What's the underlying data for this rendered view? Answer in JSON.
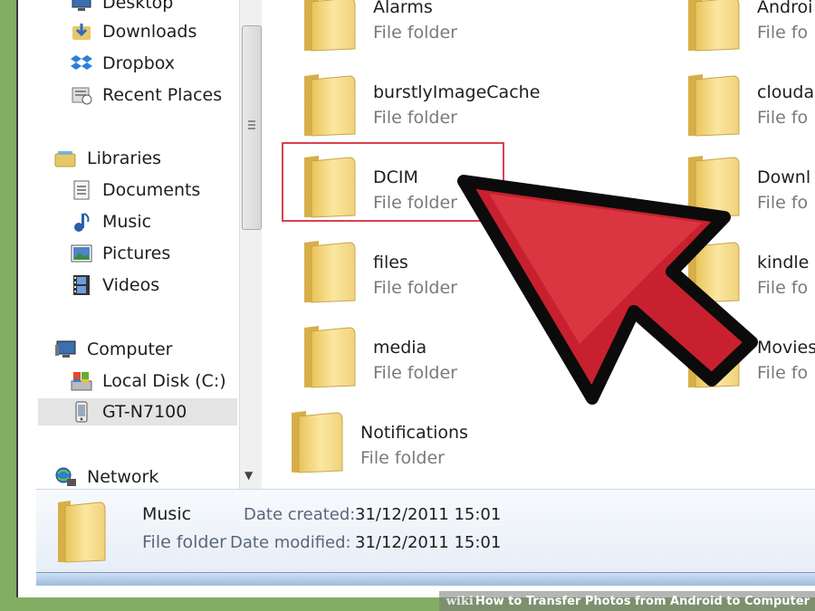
{
  "navigation": {
    "favorites": [
      {
        "label": "Desktop",
        "icon": "desktop-icon"
      },
      {
        "label": "Downloads",
        "icon": "downloads-icon"
      },
      {
        "label": "Dropbox",
        "icon": "dropbox-icon"
      },
      {
        "label": "Recent Places",
        "icon": "recent-places-icon"
      }
    ],
    "libraries": {
      "label": "Libraries",
      "icon": "libraries-icon",
      "items": [
        {
          "label": "Documents",
          "icon": "documents-icon"
        },
        {
          "label": "Music",
          "icon": "music-icon"
        },
        {
          "label": "Pictures",
          "icon": "pictures-icon"
        },
        {
          "label": "Videos",
          "icon": "videos-icon"
        }
      ]
    },
    "computer": {
      "label": "Computer",
      "icon": "computer-icon",
      "items": [
        {
          "label": "Local Disk (C:)",
          "icon": "local-disk-icon"
        },
        {
          "label": "GT-N7100",
          "icon": "phone-device-icon",
          "selected": true
        }
      ]
    },
    "network": {
      "label": "Network",
      "icon": "network-icon"
    }
  },
  "folders": [
    {
      "name": "Alarms",
      "type": "File folder"
    },
    {
      "name": "Androi",
      "type": "File fo"
    },
    {
      "name": "burstlyImageCache",
      "type": "File folder"
    },
    {
      "name": "clouda",
      "type": "File fo"
    },
    {
      "name": "DCIM",
      "type": "File folder"
    },
    {
      "name": "Downl",
      "type": "File fo"
    },
    {
      "name": "files",
      "type": "File folder"
    },
    {
      "name": "kindle",
      "type": "File fo"
    },
    {
      "name": "media",
      "type": "File folder"
    },
    {
      "name": "Movies",
      "type": "File fo"
    },
    {
      "name": "Notifications",
      "type": "File folder"
    }
  ],
  "details": {
    "name": "Music",
    "type": "File folder",
    "date_created_label": "Date created:",
    "date_created": "31/12/2011 15:01",
    "date_modified_label": "Date modified:",
    "date_modified": "31/12/2011 15:01"
  },
  "credit": {
    "brand": "wiki",
    "title": "How to Transfer Photos from Android to Computer"
  },
  "colors": {
    "highlight": "#d9414e",
    "arrow_fill": "#c8202e",
    "folder": "#f3d679"
  }
}
